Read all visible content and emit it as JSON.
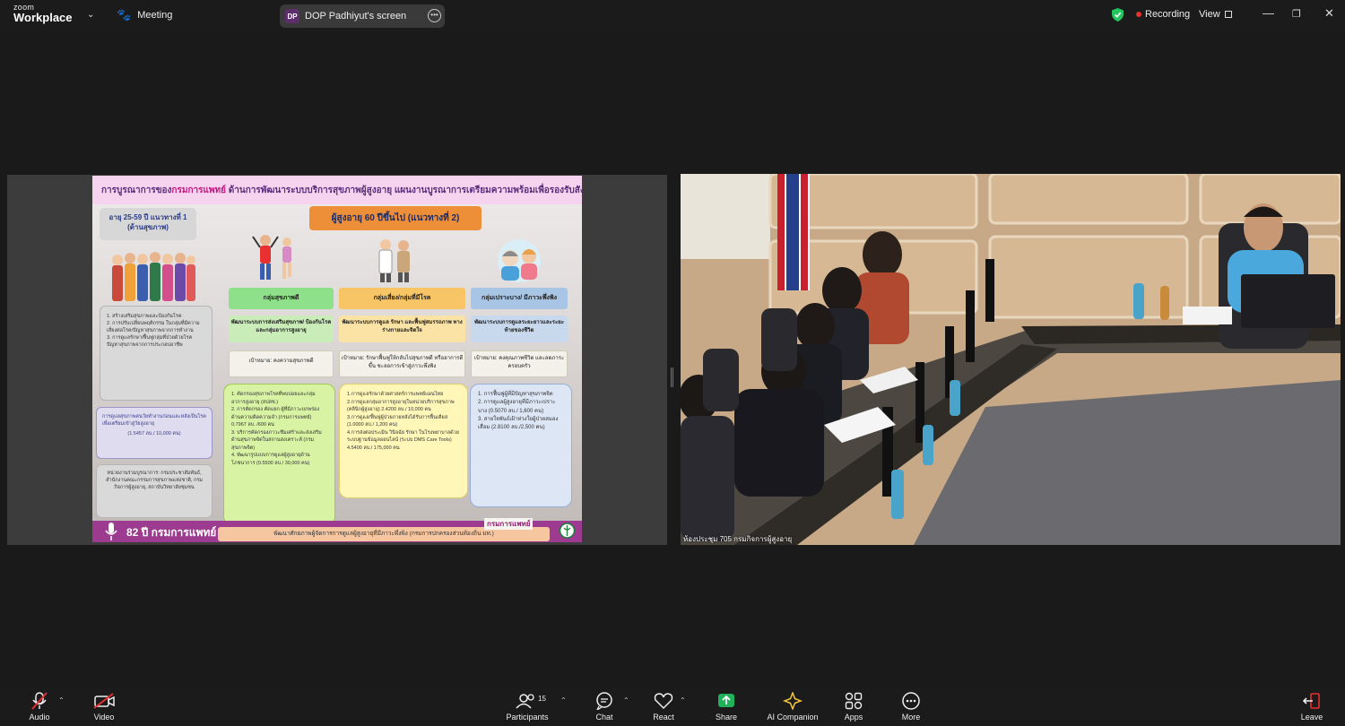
{
  "app": {
    "brand_small": "zoom",
    "brand_large": "Workplace"
  },
  "topbar": {
    "meeting_label": "Meeting",
    "sharer_initials": "DP",
    "sharer_label": "DOP Padhiyut's screen",
    "recording_label": "Recording",
    "view_label": "View"
  },
  "slide": {
    "title_prefix": "การบูรณาการของ",
    "title_highlight": "กรมการแพทย์",
    "title_suffix": " ด้านการพัฒนาระบบบริการสุขภาพผู้สูงอายุ แผนงานบูรณาการเตรียมความพร้อมเพื่อรองรับสังคมสูงวัย",
    "age_group": "อายุ 25-59 ปี แนวทางที่ 1",
    "age_group_sub": "(ด้านสุขภาพ)",
    "elderly_group": "ผู้สูงอายุ 60 ปีขึ้นไป (แนวทางที่ 2)",
    "left_box_1": "1. สร้างเสริมสุขภาพและป้องกันโรค\n2. การปรับเปลี่ยนพฤติกรรม ในกลุ่มที่มีความเสี่ยงต่อโรค/ปัญหาสุขภาพจากการทำงาน\n3. การดูแลรักษา/ฟื้นฟูกลุ่มที่ป่วยด้วยโรคปัญหาสุขภาพจากการประกอบอาชีพ",
    "left_box_2": "การดูแลสุขภาพคนวัยทำงานก่อนและหลังเป็นโรคเพื่อเตรียมเข้าสู่วัยสูงอายุ",
    "left_box_2_target": "(1.5457 ลบ./ 10,000 คน)",
    "left_box_3": "หน่วยงานร่วมบูรณาการ: กรมประชาสัมพันธ์, สำนักงานคณะกรรมการสุขภาพแห่งชาติ, กรมกิจการผู้สูงอายุ, สถาบันวิทยาลัยชุมชน",
    "col1_header": "กลุ่มสุขภาพดี",
    "col1_sub": "พัฒนาระบบการส่งเสริมสุขภาพ/ ป้องกันโรคและกลุ่มอาการสูงอายุ",
    "col1_goal": "เป้าหมาย: คงความสุขภาพดี",
    "col1_list": "1. คัดกรองสุขภาพโรคที่พบบ่อยและกลุ่มอาการสูงอายุ (สปสช.)\n2. การคัดกรอง คัดแยก ผู้ที่มีภาวะบกพร่องด้านความคิดความจำ (กรมการแพทย์) 0.7967 ลบ. /600 คน\n3. บริการคัดกรองภาวะซึมเศร้าและส่งเสริมด้านสุขภาพจิตในสถานสงเคราะห์ (กรมสุขภาพจิต)\n4. พัฒนารูปแบบการดูแลผู้สูงอายุด้านโภชนาการ (0.5500 ลบ./ 30,000 คน)",
    "col2_header": "กลุ่มเสี่ยง/กลุ่มที่มีโรค",
    "col2_sub": "พัฒนาระบบการดูแล รักษา และฟื้นฟูสมรรถภาพ ทางร่างกายและจิตใจ",
    "col2_goal": "เป้าหมาย: รักษาฟื้นฟูให้กลับไปสุขภาพดี หรืออาการดีขึ้น ชะลอการเข้าสู่ภาวะพึ่งพิง",
    "col2_list": "1.การดูแลรักษาด้วยศาสตร์การแพทย์แผนไทย\n2.การดูแลกลุ่มอาการสูงอายุในหน่วยบริการสุขภาพ (คลินิกผู้สูงอายุ) 2.4200 ลบ./ 10,000 คน\n3.การดูแล/ฟื้นฟูผู้ป่วยภายหลังได้รับการฟื้นเคียส (1.0000 ลบ./ 1,200 คน)\n4.การส่งต่อประเมิน วินิจฉัย รักษา ในโรงพยาบาลด้วยระบบฐานข้อมูลออนไลน์ (ระบบ DMS Care Tools) 4.5400 ลบ./ 175,000 คน",
    "col3_header": "กลุ่มเปราะบาง/ มีภาวะพึ่งพิง",
    "col3_sub": "พัฒนาระบบการดูแลระยะยาวและระยะท้ายของชีวิต",
    "col3_goal": "เป้าหมาย: คงคุณภาพชีวิต และลดภาระครอบครัว",
    "col3_list": "1. การฟื้นฟูผู้ที่มีปัญหาสุขภาพจิต\n2. การดูแลผู้สูงอายุที่มีภาวะเปราะบาง (0.5070 ลบ./ 1,600 คน)\n3. สายใจพันธ์เฝ้าห่วงใยผู้ป่วยสมองเสื่อม (2.8100 ลบ./2,500 คน)",
    "footer_left": "82 ปี กรมการแพทย์",
    "footer_mid": "พัฒนาศักยภาพผู้จัดการการดูแลผู้สูงอายุที่มีภาวะพึ่งพิง (กรมการปกครองส่วนท้องถิ่น มท.)",
    "footer_right": "กรมการแพทย์"
  },
  "video": {
    "label": "ห้องประชุม 705 กรมกิจการผู้สูงอายุ"
  },
  "toolbar": {
    "audio": "Audio",
    "video": "Video",
    "participants": "Participants",
    "participants_count": "15",
    "chat": "Chat",
    "react": "React",
    "share": "Share",
    "ai_companion": "AI Companion",
    "apps": "Apps",
    "more": "More",
    "leave": "Leave"
  },
  "colors": {
    "accent_green": "#22c55e",
    "share_green": "#20b15a",
    "recording_red": "#e5302f",
    "leave_red": "#e5302f"
  }
}
